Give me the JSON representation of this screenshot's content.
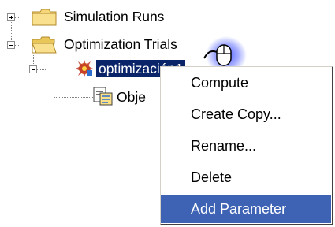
{
  "tree": {
    "items": [
      {
        "label": "Simulation Runs",
        "expanded": false
      },
      {
        "label": "Optimization Trials",
        "expanded": true
      },
      {
        "label": "optimización1",
        "selected": true
      },
      {
        "label": "Obje"
      }
    ]
  },
  "context_menu": {
    "items": [
      {
        "label": "Compute"
      },
      {
        "label": "Create Copy..."
      },
      {
        "label": "Rename..."
      },
      {
        "label": "Delete"
      },
      {
        "label": "Add Parameter",
        "highlighted": true
      }
    ]
  },
  "colors": {
    "selection": "#0a246a",
    "menu_highlight": "#3e63b4",
    "folder": "#f5d77a"
  },
  "icons": [
    "expand-icon",
    "collapse-icon",
    "folder-icon",
    "folder-open-icon",
    "optimization-icon",
    "objective-icon",
    "mouse-cursor-icon"
  ]
}
